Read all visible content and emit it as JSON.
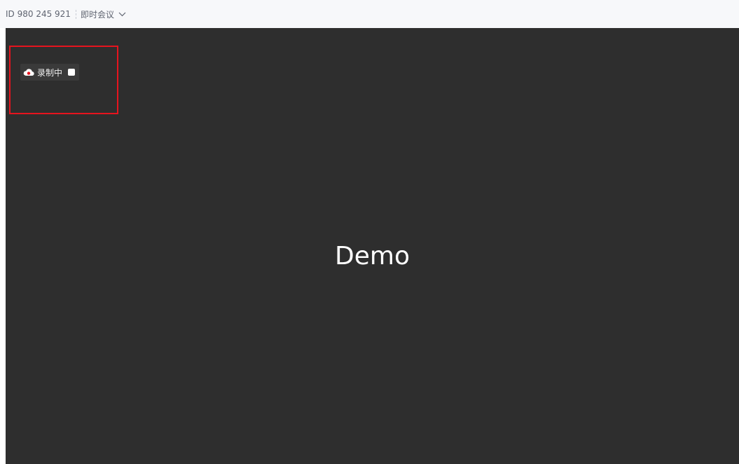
{
  "header": {
    "meeting_id": "ID 980 245 921",
    "meeting_type": "即时会议",
    "dropdown_icon": "chevron-down-icon"
  },
  "stage": {
    "recording_status": "录制中",
    "recording_icon": "cloud-record-icon",
    "stop_icon": "stop-square-icon",
    "content_label": "Demo"
  },
  "colors": {
    "stage_bg": "#2e2e2e",
    "highlight_border": "#e6141e",
    "recording_dot": "#e6141e",
    "header_bg": "#f7f8fa"
  }
}
